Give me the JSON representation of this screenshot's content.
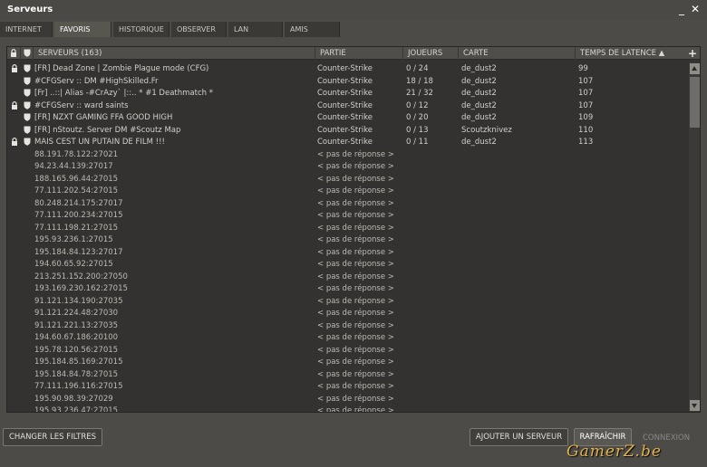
{
  "window": {
    "title": "Serveurs",
    "minimize": "_",
    "close": "✕"
  },
  "tabs": [
    {
      "label": "INTERNET"
    },
    {
      "label": "FAVORIS",
      "active": true
    },
    {
      "label": "HISTORIQUE"
    },
    {
      "label": "OBSERVER"
    },
    {
      "label": "LAN"
    },
    {
      "label": "AMIS"
    }
  ],
  "columns": {
    "lock_icon": "lock-icon",
    "fav_icon": "shield-icon",
    "server": "SERVEURS (163)",
    "game": "PARTIE",
    "players": "JOUEURS",
    "map": "CARTE",
    "latency": "TEMPS DE LATENCE ▲",
    "add": "+"
  },
  "favorites": [
    {
      "locked": true,
      "name": "[FR] Dead Zone | Zombie Plague mode (CFG)",
      "game": "Counter-Strike",
      "players": "0 / 24",
      "map": "de_dust2",
      "ping": "99"
    },
    {
      "locked": false,
      "name": "#CFGServ :: DM #HighSkilled.Fr",
      "game": "Counter-Strike",
      "players": "18 / 18",
      "map": "de_dust2",
      "ping": "107"
    },
    {
      "locked": false,
      "name": "[Fr] ..::| Alias -#CrAzy` |::.. * #1 Deathmatch *",
      "game": "Counter-Strike",
      "players": "21 / 32",
      "map": "de_dust2",
      "ping": "107"
    },
    {
      "locked": true,
      "name": "#CFGServ :: ward saints",
      "game": "Counter-Strike",
      "players": "0 / 12",
      "map": "de_dust2",
      "ping": "107"
    },
    {
      "locked": false,
      "name": "[FR] NZXT GAMING FFA GOOD HIGH",
      "game": "Counter-Strike",
      "players": "0 / 20",
      "map": "de_dust2",
      "ping": "109"
    },
    {
      "locked": false,
      "name": "[FR] nStoutz. Server DM #Scoutz Map",
      "game": "Counter-Strike",
      "players": "0 / 13",
      "map": "Scoutzknivez",
      "ping": "110"
    },
    {
      "locked": true,
      "name": "MAIS CEST UN PUTAIN DE FILM !!!",
      "game": "Counter-Strike",
      "players": "0 / 11",
      "map": "de_dust2",
      "ping": "113"
    }
  ],
  "no_response_label": "< pas de réponse >",
  "history": [
    "88.191.78.122:27021",
    "94.23.44.139:27017",
    "188.165.96.44:27015",
    "77.111.202.54:27015",
    "80.248.214.175:27017",
    "77.111.200.234:27015",
    "77.111.198.21:27015",
    "195.93.236.1:27015",
    "195.184.84.123:27017",
    "194.60.65.92:27015",
    "213.251.152.200:27050",
    "193.169.230.162:27015",
    "91.121.134.190:27035",
    "91.121.224.48:27030",
    "91.121.221.13:27035",
    "194.60.67.186:20100",
    "195.78.120.56:27015",
    "195.184.85.169:27015",
    "195.184.84.78:27015",
    "77.111.196.116:27015",
    "195.90.98.39:27029",
    "195.93.236.47:27015"
  ],
  "buttons": {
    "filters": "CHANGER LES FILTRES",
    "add_server": "AJOUTER UN SERVEUR",
    "refresh": "RAFRAÎCHIR",
    "connect": "CONNEXION"
  },
  "watermark": "GamerZ.be"
}
